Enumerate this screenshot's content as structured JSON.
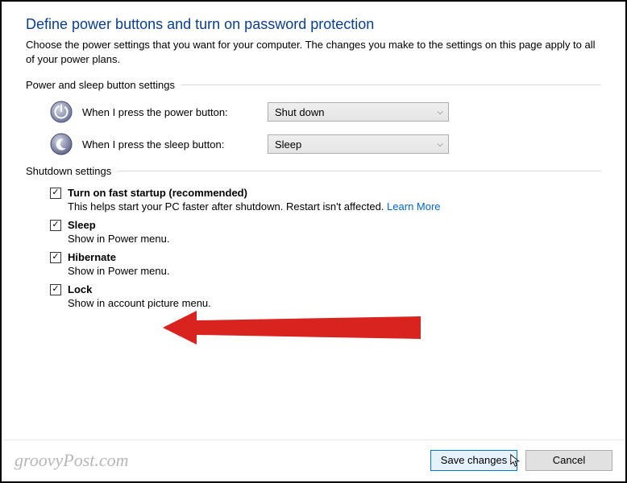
{
  "header": {
    "title": "Define power buttons and turn on password protection",
    "intro": "Choose the power settings that you want for your computer. The changes you make to the settings on this page apply to all of your power plans."
  },
  "sections": {
    "buttons_header": "Power and sleep button settings",
    "shutdown_header": "Shutdown settings"
  },
  "buttons": {
    "power_label": "When I press the power button:",
    "power_value": "Shut down",
    "sleep_label": "When I press the sleep button:",
    "sleep_value": "Sleep"
  },
  "shutdown": {
    "items": [
      {
        "title": "Turn on fast startup (recommended)",
        "desc": "This helps start your PC faster after shutdown. Restart isn't affected.",
        "link": "Learn More",
        "checked": true
      },
      {
        "title": "Sleep",
        "desc": "Show in Power menu.",
        "checked": true
      },
      {
        "title": "Hibernate",
        "desc": "Show in Power menu.",
        "checked": true
      },
      {
        "title": "Lock",
        "desc": "Show in account picture menu.",
        "checked": true
      }
    ]
  },
  "footer": {
    "watermark": "groovyPost.com",
    "save": "Save changes",
    "cancel": "Cancel"
  },
  "annotation": {
    "arrow_target": "Hibernate",
    "arrow_color": "#d8231f"
  }
}
